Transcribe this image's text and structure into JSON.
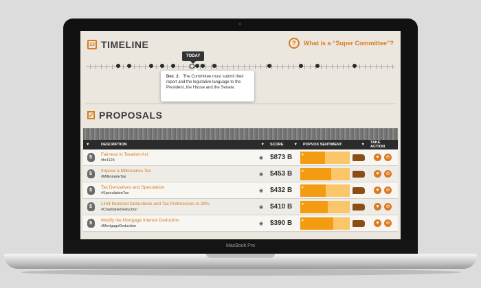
{
  "device": {
    "model_label": "MacBook Pro"
  },
  "timeline": {
    "title": "TIMELINE",
    "calendar_day": "23",
    "question_link": "What is a “Super Committee”?",
    "today_label": "TODAY",
    "popup": {
      "date": "Dec. 2.",
      "text": "The Committee must submit their report and the legislative language to the President, the House and the Senate."
    }
  },
  "proposals": {
    "title": "PROPOSALS",
    "columns": {
      "description": "DESCRIPTION",
      "score": "SCORE",
      "sentiment": "POPVOX SENTIMENT",
      "action": "TAKE ACTION"
    },
    "rows": [
      {
        "name": "Fairness in Taxation Act",
        "tag": "#hr1124",
        "score": "$873 B",
        "sentiment_support": 0.5
      },
      {
        "name": "Impose a Millionaires Tax",
        "tag": "#MillionaireTax",
        "score": "$453 B",
        "sentiment_support": 0.62
      },
      {
        "name": "Tax Derivatives and Speculation",
        "tag": "#SpeculationTax",
        "score": "$432 B",
        "sentiment_support": 0.52
      },
      {
        "name": "Limit Itemized Deductions and Tax Preferences to 28%",
        "tag": "#CharitableDeduction",
        "score": "$410 B",
        "sentiment_support": 0.55
      },
      {
        "name": "Modify the Mortgage Interest Deduction",
        "tag": "#MortgageDeduction",
        "score": "$390 B",
        "sentiment_support": 0.66
      }
    ]
  },
  "icons": {
    "calendar": "calendar-icon",
    "question": "question-circle-icon",
    "check": "checkbox-icon",
    "money_bag": "money-bag-icon",
    "view": "eye-icon",
    "map": "us-map-icon",
    "support": "heart-icon",
    "oppose": "no-icon"
  },
  "colors": {
    "accent": "#d97b20",
    "bar_dark": "#f39c12",
    "bar_light": "#fbc56a",
    "header": "#2b2b2b"
  }
}
